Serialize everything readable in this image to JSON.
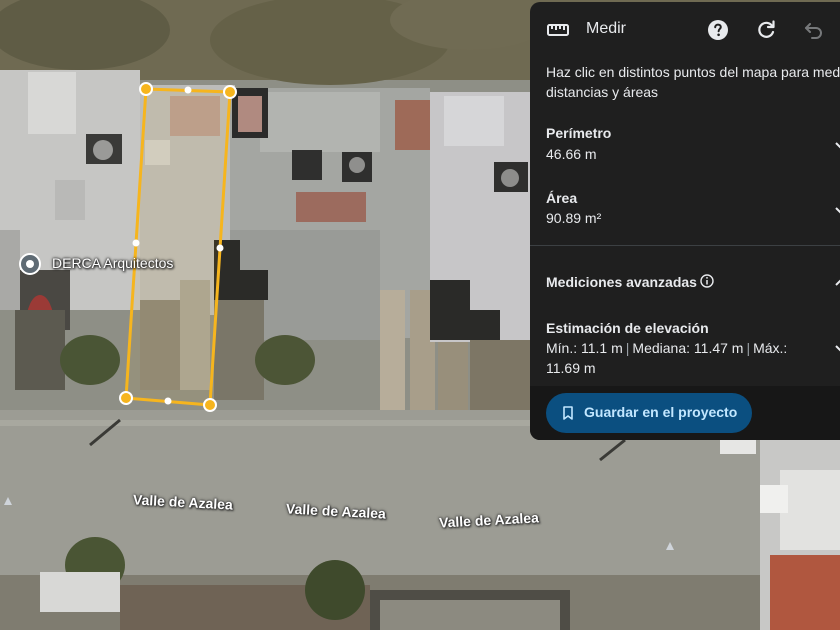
{
  "map": {
    "streets": [
      {
        "name": "Valle de Azalea"
      },
      {
        "name": "Valle de Azalea"
      },
      {
        "name": "Valle de Azalea"
      }
    ],
    "place_label": "DERCA Arquitectos",
    "measure_color": "#f6b51e"
  },
  "panel": {
    "title": "Medir",
    "icons": {
      "tool": "ruler-icon",
      "help": "help-icon",
      "refresh": "refresh-icon",
      "undo": "undo-icon"
    },
    "instructions_line1": "Haz clic en distintos puntos del mapa para medir",
    "instructions_line2": "distancias y áreas",
    "perimeter_label": "Perímetro",
    "perimeter_value": "46.66 m",
    "area_label": "Área",
    "area_value": "90.89 m²",
    "advanced_label": "Mediciones avanzadas",
    "elevation_label": "Estimación de elevación",
    "elevation_min": "Mín.: 11.1 m",
    "elevation_median": "Mediana: 11.47 m",
    "elevation_max_label": "Máx.:",
    "elevation_max_value": "11.69 m",
    "save_button": "Guardar en el proyecto",
    "colors": {
      "panel_bg": "#1f1f1f",
      "button_bg": "#0b4f80",
      "button_text": "#c2e7ff"
    }
  }
}
